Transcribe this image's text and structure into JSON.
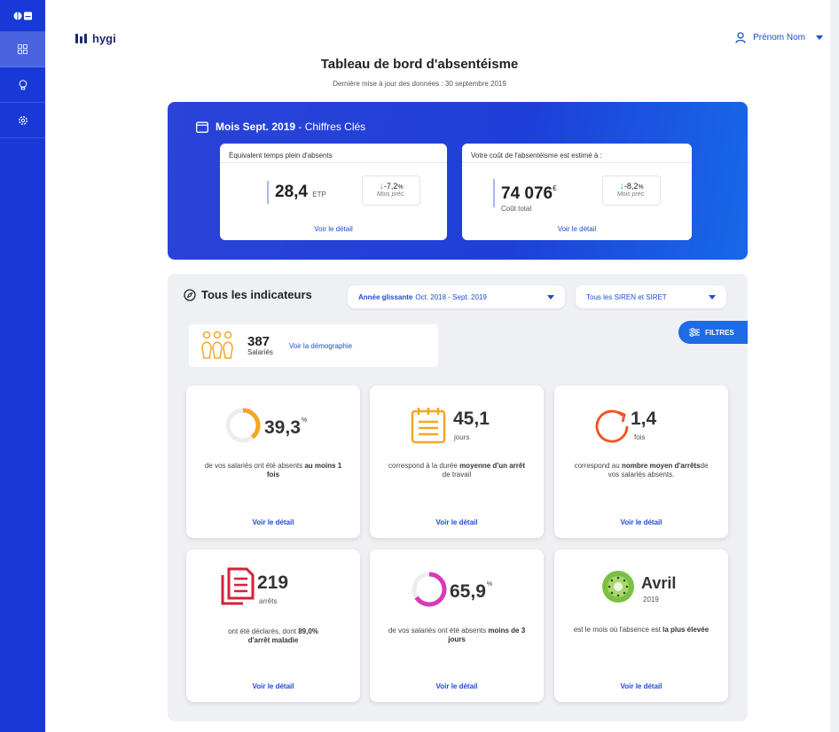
{
  "app": {
    "brand": "hygi"
  },
  "user": {
    "name": "Prénom Nom"
  },
  "sidebar": {
    "items": [
      {
        "icon": "dashboard-icon",
        "active": true
      },
      {
        "icon": "lightbulb-icon",
        "active": false
      },
      {
        "icon": "gear-icon",
        "active": false
      }
    ]
  },
  "page": {
    "title": "Tableau de bord d'absentéisme",
    "updated": "Dernière mise à jour des données : 30 septembre 2019"
  },
  "key_figures": {
    "month_label": "Mois Sept. 2019",
    "suffix": " - Chiffres Clés",
    "fte": {
      "title": "Équivalent temps plein d'absents",
      "value": "28,4",
      "unit": "ETP",
      "delta": "-7,2",
      "delta_unit": "%",
      "delta_label": "Mois préc.",
      "link": "Voir le détail"
    },
    "cost": {
      "title": "Votre coût de l'absentéisme est estimé à :",
      "value": "74 076",
      "unit": "€",
      "sublabel": "Coût total",
      "delta": "-8,2",
      "delta_unit": "%",
      "delta_label": "Mois préc.",
      "link": "Voir le détail"
    }
  },
  "indicators": {
    "title": "Tous les indicateurs",
    "period_prefix": "Année glissante",
    "period_value": "Oct. 2018 - Sept. 2019",
    "siren": "Tous les SIREN et SIRET",
    "filters": "FILTRES",
    "employees_count": "387",
    "employees_label": "Salariés",
    "demo_link": "Voir la démographie",
    "cards": [
      {
        "value": "39,3",
        "unit": "%",
        "d1": "de vos salariés ont été absents ",
        "d2": "au moins 1 fois",
        "link": "Voir le détail",
        "pct": 0.393
      },
      {
        "value": "45,1",
        "unit": "jours",
        "d1": "correspond à la durée ",
        "d2": "moyenne d'un arrêt",
        "d3": " de travail",
        "link": "Voir le détail"
      },
      {
        "value": "1,4",
        "unit": "fois",
        "d1": "correspond au ",
        "d2": "nombre moyen d'arrêts",
        "d3": "de vos salariés absents.",
        "link": "Voir le détail"
      },
      {
        "value": "219",
        "unit": "arrêts",
        "d1": "ont été déclarés, dont ",
        "d2": "89,0%",
        "d3": "d'arrêt maladie",
        "link": "Voir le détail"
      },
      {
        "value": "65,9",
        "unit": "%",
        "d1": "de vos salariés ont été absents ",
        "d2": "moins de 3 jours",
        "link": "Voir le détail",
        "pct": 0.659
      },
      {
        "value": "Avril",
        "unit": "2019",
        "d1": "est le mois où l'absence est ",
        "d2": "la plus élevée",
        "link": "Voir le détail"
      }
    ]
  },
  "colors": {
    "sidebar": "#1839d8",
    "accent": "#1e4bd6",
    "orange": "#f5a623",
    "red": "#f4511e",
    "crimson": "#d6213a",
    "magenta": "#d63ab7",
    "green": "#2bb673"
  }
}
